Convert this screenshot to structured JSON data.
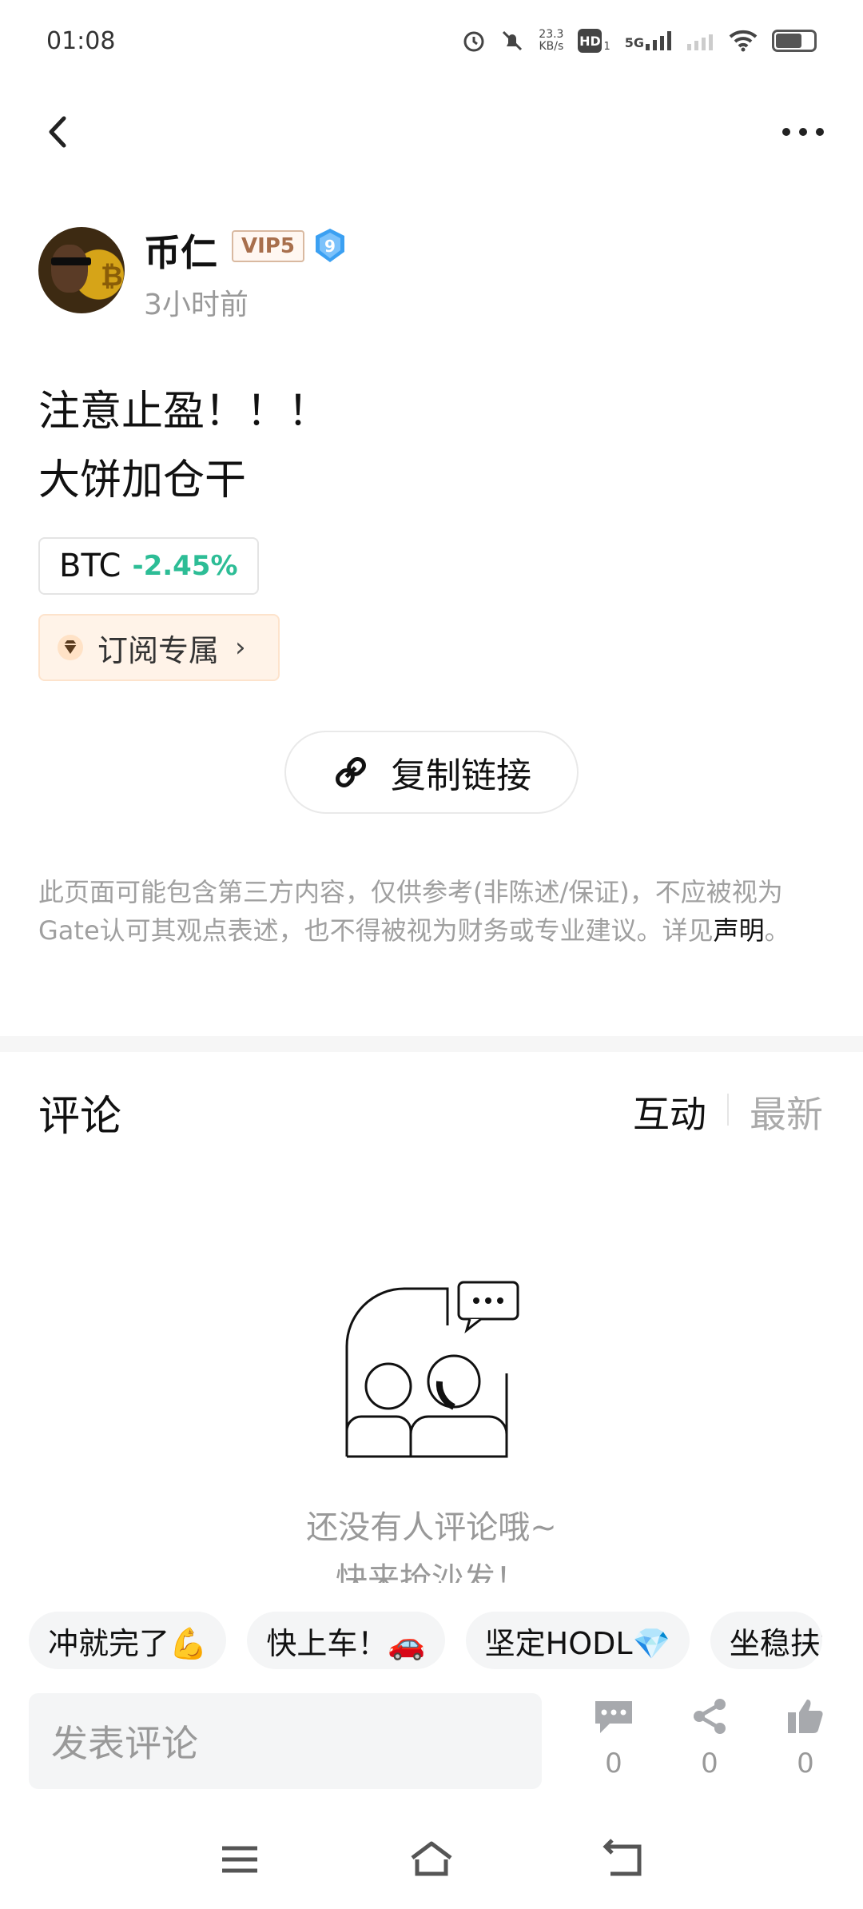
{
  "status_bar": {
    "time": "01:08",
    "net_speed_value": "23.3",
    "net_speed_unit": "KB/s",
    "hd_label": "HD",
    "hd_sub": "1",
    "signal_label": "5G",
    "battery_level": 0.7
  },
  "author": {
    "name": "币仁",
    "vip_label": "VIP5",
    "level": "9",
    "time_ago": "3小时前"
  },
  "post": {
    "lines": [
      "注意止盈！！！",
      "大饼加仓干"
    ],
    "coin_tag": {
      "symbol": "BTC",
      "change": "-2.45%"
    },
    "subscribe_label": "订阅专属",
    "subscribe_arrow": "›",
    "copy_link_label": "复制链接"
  },
  "disclaimer": {
    "text": "此页面可能包含第三方内容，仅供参考(非陈述/保证)，不应被视为Gate认可其观点表述，也不得被视为财务或专业建议。详见",
    "link": "声明",
    "end": "。"
  },
  "comments": {
    "title": "评论",
    "tabs": [
      "互动",
      "最新"
    ],
    "empty_line1": "还没有人评论哦~",
    "empty_line2": "快来抢沙发！"
  },
  "quick_replies": [
    "冲就完了💪",
    "快上车！🚗",
    "坚定HODL💎",
    "坐稳扶好"
  ],
  "bottom_bar": {
    "input_placeholder": "发表评论",
    "comment_count": "0",
    "share_count": "0",
    "like_count": "0"
  },
  "colors": {
    "up_green": "#2dbd96",
    "vip_brown": "#a86f4c",
    "level_blue": "#3ba0f2",
    "muted_gray": "#999999"
  },
  "icons": [
    "back-icon",
    "more-icon",
    "level-shield-icon",
    "diamond-icon",
    "chevron-right-icon",
    "link-icon",
    "comment-icon",
    "share-icon",
    "thumbs-up-icon",
    "menu-icon",
    "home-icon",
    "back-nav-icon"
  ]
}
